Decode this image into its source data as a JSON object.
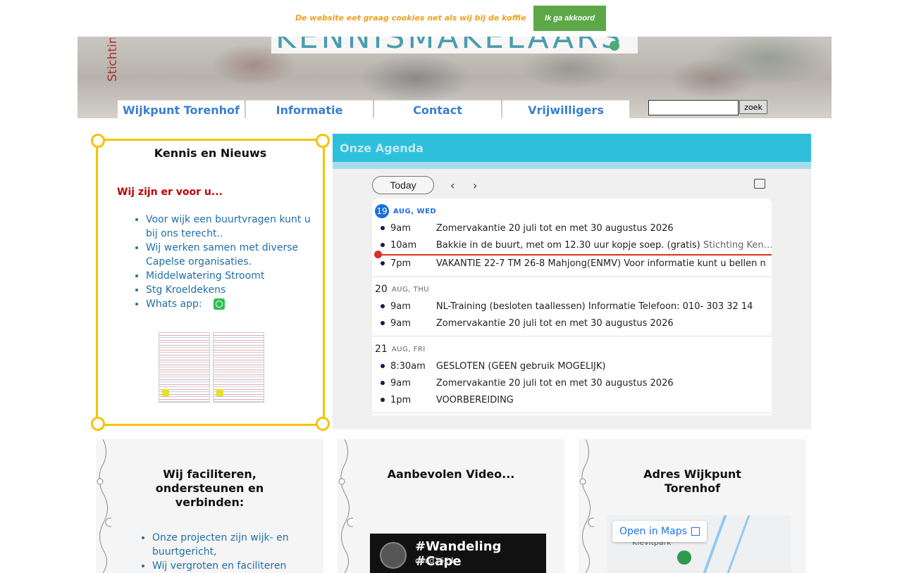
{
  "cookie": {
    "message": "De website eet graag cookies net als wij bij de koffie",
    "accept_label": "Ik ga akkoord"
  },
  "header": {
    "side_text": "Stichtin",
    "logo_text": "KENNISMAKELAARS"
  },
  "nav": {
    "items": [
      {
        "label": "Wijkpunt Torenhof"
      },
      {
        "label": "Informatie"
      },
      {
        "label": "Contact"
      },
      {
        "label": "Vrijwilligers"
      }
    ]
  },
  "search": {
    "value": "",
    "button_label": "zoek"
  },
  "news": {
    "title": "Kennis en Nieuws",
    "subtitle": "Wij zijn er voor u...",
    "items": [
      "Voor wijk een buurtvragen kunt u bij ons terecht..",
      "Wij werken samen met diverse Capelse organisaties.",
      "Middelwatering Stroomt",
      "Stg Kroeldekens",
      "Whats app:"
    ]
  },
  "agenda": {
    "title": "Onze Agenda",
    "today_label": "Today",
    "prev_icon": "‹",
    "next_icon": "›",
    "days": [
      {
        "num": "19",
        "label": "AUG, WED",
        "is_today": true,
        "events": [
          {
            "time": "9am",
            "title": "Zomervakantie 20 juli tot en met 30 augustus 2026",
            "extra": ""
          },
          {
            "time": "10am",
            "title": "Bakkie in de buurt, met om 12.30 uur kopje soep. (gratis)",
            "extra": " Stichting Ken…"
          },
          {
            "time": "7pm",
            "title": "VAKANTIE 22-7 TM 26-8 Mahjong(ENMV) Voor informatie kunt u bellen n",
            "extra": ""
          }
        ]
      },
      {
        "num": "20",
        "label": "AUG, THU",
        "is_today": false,
        "events": [
          {
            "time": "9am",
            "title": "NL-Training (besloten taallessen) Informatie Telefoon: 010- 303 32 14",
            "extra": ""
          },
          {
            "time": "9am",
            "title": "Zomervakantie 20 juli tot en met 30 augustus 2026",
            "extra": ""
          }
        ]
      },
      {
        "num": "21",
        "label": "AUG, FRI",
        "is_today": false,
        "events": [
          {
            "time": "8:30am",
            "title": "GESLOTEN (GEEN gebruik MOGELIJK)",
            "extra": ""
          },
          {
            "time": "9am",
            "title": "Zomervakantie 20 juli tot en met 30 augustus 2026",
            "extra": ""
          },
          {
            "time": "1pm",
            "title": "VOORBEREIDING",
            "extra": ""
          }
        ]
      }
    ]
  },
  "cards": {
    "facilitate": {
      "title_line1": "Wij faciliteren,",
      "title_line2": "ondersteunen en",
      "title_line3": "verbinden:",
      "items": [
        "Onze projecten zijn wijk- en buurtgericht,",
        "Wij vergroten en faciliteren"
      ]
    },
    "video": {
      "title": "Aanbevolen Video...",
      "video_title": "#Wandeling #Cape",
      "video_channel": "ooud2624"
    },
    "address": {
      "title_line1": "Adres Wijkpunt",
      "title_line2": "Torenhof",
      "map_button": "Open in Maps",
      "map_label": "Kievitpark"
    }
  }
}
